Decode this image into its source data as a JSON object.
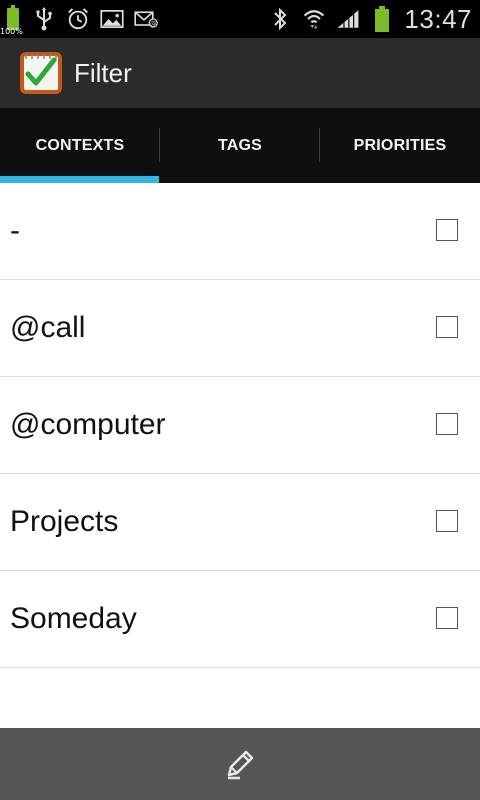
{
  "status_bar": {
    "battery_small_label": "100%",
    "time": "13:47",
    "icons": [
      "battery-icon",
      "usb-icon",
      "alarm-icon",
      "gallery-icon",
      "email-icon",
      "bluetooth-icon",
      "wifi-icon",
      "signal-icon",
      "battery-full-icon"
    ]
  },
  "action_bar": {
    "title": "Filter"
  },
  "tabs": [
    {
      "label": "CONTEXTS",
      "selected": true
    },
    {
      "label": "TAGS",
      "selected": false
    },
    {
      "label": "PRIORITIES",
      "selected": false
    }
  ],
  "list": {
    "items": [
      {
        "label": "-",
        "checked": false
      },
      {
        "label": "@call",
        "checked": false
      },
      {
        "label": "@computer",
        "checked": false
      },
      {
        "label": "Projects",
        "checked": false
      },
      {
        "label": "Someday",
        "checked": false
      }
    ]
  },
  "colors": {
    "accent": "#33b5e5",
    "battery": "#7dbb2a",
    "tab_bg": "#0f0f0f",
    "action_bar_bg": "#2b2b2b",
    "bottom_bar_bg": "#555555"
  },
  "bottom_bar": {
    "icon": "pencil-icon"
  }
}
